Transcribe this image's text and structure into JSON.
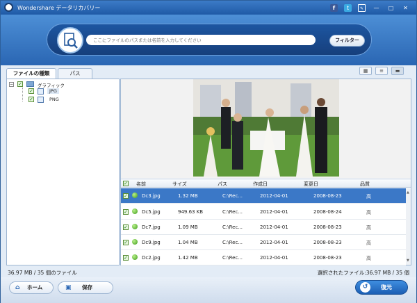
{
  "window": {
    "title": "Wondershare データリカバリー"
  },
  "search": {
    "placeholder": "ここにファイルのパスまたは名前を入力してください",
    "filter_label": "フィルター"
  },
  "tabs": [
    {
      "label": "ファイルの種類"
    },
    {
      "label": "パス"
    }
  ],
  "tree": {
    "root_label": "グラフィック",
    "children": [
      {
        "label": "JPG"
      },
      {
        "label": "PNG"
      }
    ]
  },
  "table": {
    "headers": {
      "name": "名前",
      "size": "サイズ",
      "path": "パス",
      "created": "作成日",
      "modified": "変更日",
      "quality": "品質"
    },
    "rows": [
      {
        "name": "Dc3.jpg",
        "size": "1.32 MB",
        "path": "C:\\Rec...",
        "created": "2012-04-01",
        "modified": "2008-08-23",
        "quality": "高"
      },
      {
        "name": "Dc5.jpg",
        "size": "949.63 KB",
        "path": "C:\\Rec...",
        "created": "2012-04-01",
        "modified": "2008-08-24",
        "quality": "高"
      },
      {
        "name": "Dc7.jpg",
        "size": "1.09 MB",
        "path": "C:\\Rec...",
        "created": "2012-04-01",
        "modified": "2008-08-23",
        "quality": "高"
      },
      {
        "name": "Dc9.jpg",
        "size": "1.04 MB",
        "path": "C:\\Rec...",
        "created": "2012-04-01",
        "modified": "2008-08-23",
        "quality": "高"
      },
      {
        "name": "Dc2.jpg",
        "size": "1.42 MB",
        "path": "C:\\Rec...",
        "created": "2012-04-01",
        "modified": "2008-08-23",
        "quality": "高"
      }
    ]
  },
  "status": {
    "left": "36.97 MB / 35 個のファイル",
    "right": "選択されたファイル:36.97 MB / 35 個"
  },
  "bottom": {
    "home_label": "ホーム",
    "save_label": "保存",
    "recover_label": "復元"
  },
  "icons": [
    "app-logo-icon",
    "facebook-icon",
    "twitter-icon",
    "register-icon",
    "minimize-icon",
    "maximize-icon",
    "close-icon",
    "search-file-icon",
    "thumbnail-view-icon",
    "list-view-icon",
    "preview-view-icon",
    "home-icon",
    "save-icon",
    "recover-icon"
  ],
  "colors": {
    "accent": "#2a66b3",
    "selected_row": "#3b78c7",
    "status_ok": "#3f9b1c"
  }
}
